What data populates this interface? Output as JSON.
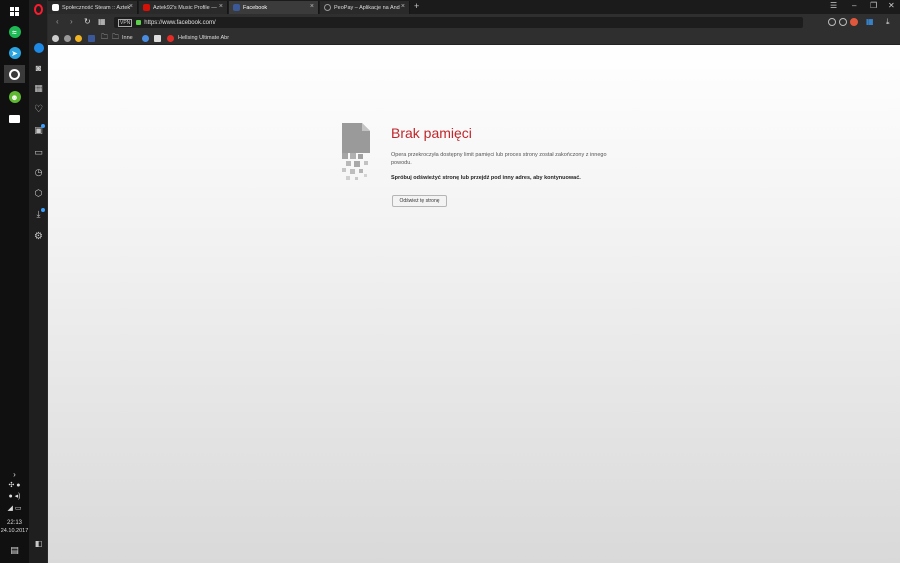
{
  "tabs": [
    {
      "title": "Społeczność Steam :: Aztek",
      "favicon_color": "#ffffff"
    },
    {
      "title": "Aztek92's Music Profile — ",
      "favicon_color": "#d51007"
    },
    {
      "title": "Facebook",
      "favicon_color": "#3b5998"
    },
    {
      "title": "PeoPay – Aplikacje na And",
      "favicon_color": "#888888"
    }
  ],
  "address": {
    "vpn": "VPN",
    "url": "https://www.facebook.com/"
  },
  "bookmarks": {
    "folder_label": "Inne",
    "item_label": "Hellsing Ultimate Abr"
  },
  "error": {
    "title": "Brak pamięci",
    "description": "Opera przekroczyła dostępny limit pamięci lub proces strony został zakończony z innego powodu.",
    "advice": "Spróbuj odświeżyć stronę lub przejdź pod inny adres, aby kontynuować.",
    "button": "Odśwież tę stronę"
  },
  "clock": {
    "time": "22:13",
    "date": "24.10.2017"
  },
  "colors": {
    "accent": "#c0262b",
    "opera": "#ff1b2d"
  }
}
